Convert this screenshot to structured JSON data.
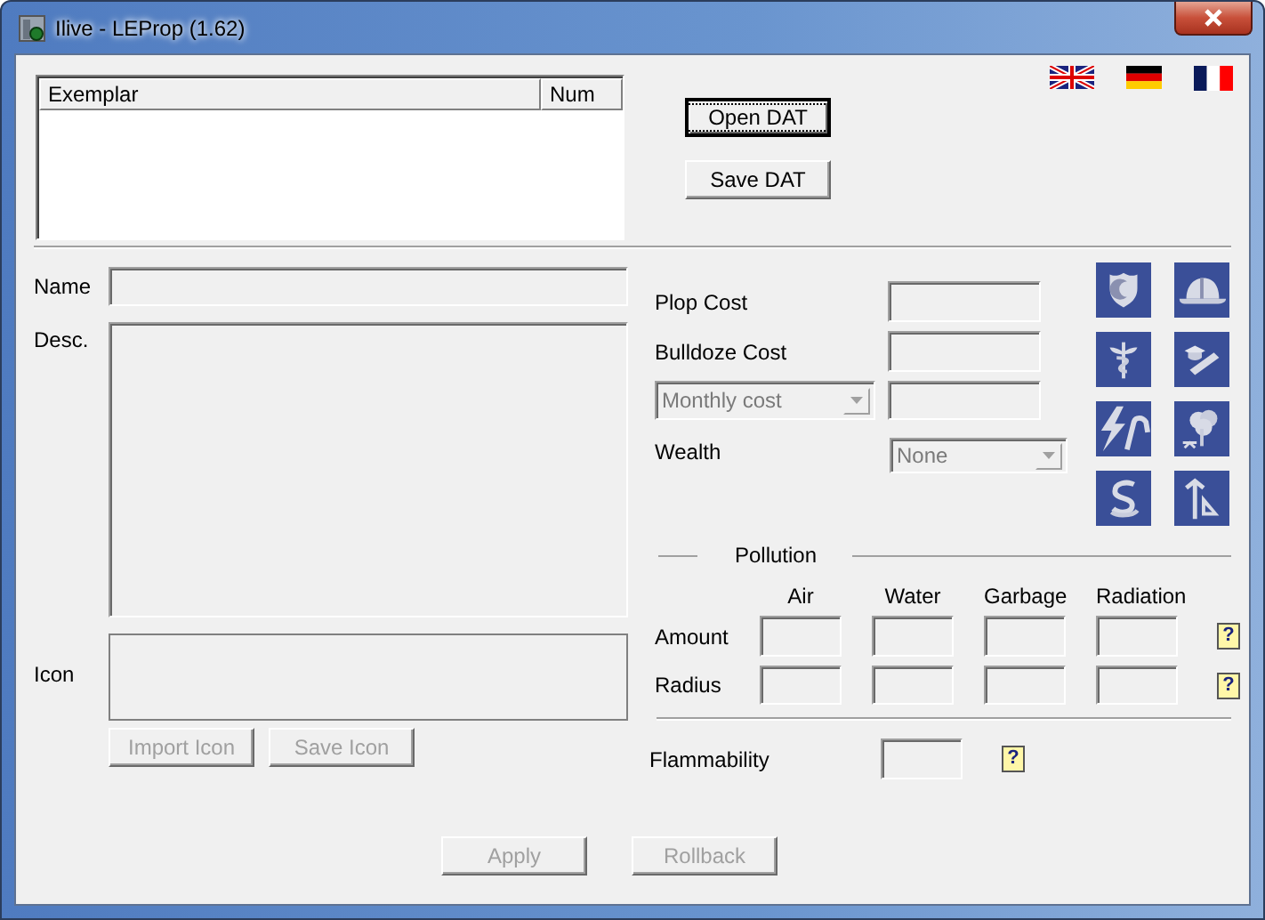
{
  "window": {
    "title": "Ilive - LEProp (1.62)"
  },
  "exemplar_list": {
    "columns": [
      "Exemplar",
      "Num"
    ]
  },
  "file_buttons": [
    {
      "label": "Open DAT",
      "focused": true
    },
    {
      "label": "Save DAT",
      "focused": false
    }
  ],
  "name_label": "Name",
  "desc_label": "Desc.",
  "icon_label": "Icon",
  "icon_buttons": [
    {
      "label": "Import Icon",
      "disabled": true
    },
    {
      "label": "Save Icon",
      "disabled": true
    }
  ],
  "costs": [
    {
      "kind": "field",
      "label": "Plop Cost"
    },
    {
      "kind": "field",
      "label": "Bulldoze Cost"
    },
    {
      "kind": "combo-field",
      "value": "Monthly cost",
      "disabled": true
    },
    {
      "kind": "combo",
      "label": "Wealth",
      "value": "None",
      "disabled": true
    }
  ],
  "pollution": {
    "title": "Pollution",
    "columns": [
      "Air",
      "Water",
      "Garbage",
      "Radiation"
    ],
    "rows": [
      {
        "label": "Amount",
        "help": "?"
      },
      {
        "label": "Radius",
        "help": "?"
      }
    ]
  },
  "flammability": {
    "label": "Flammability",
    "help": "?"
  },
  "action_buttons": [
    {
      "label": "Apply",
      "disabled": true
    },
    {
      "label": "Rollback",
      "disabled": true
    }
  ]
}
